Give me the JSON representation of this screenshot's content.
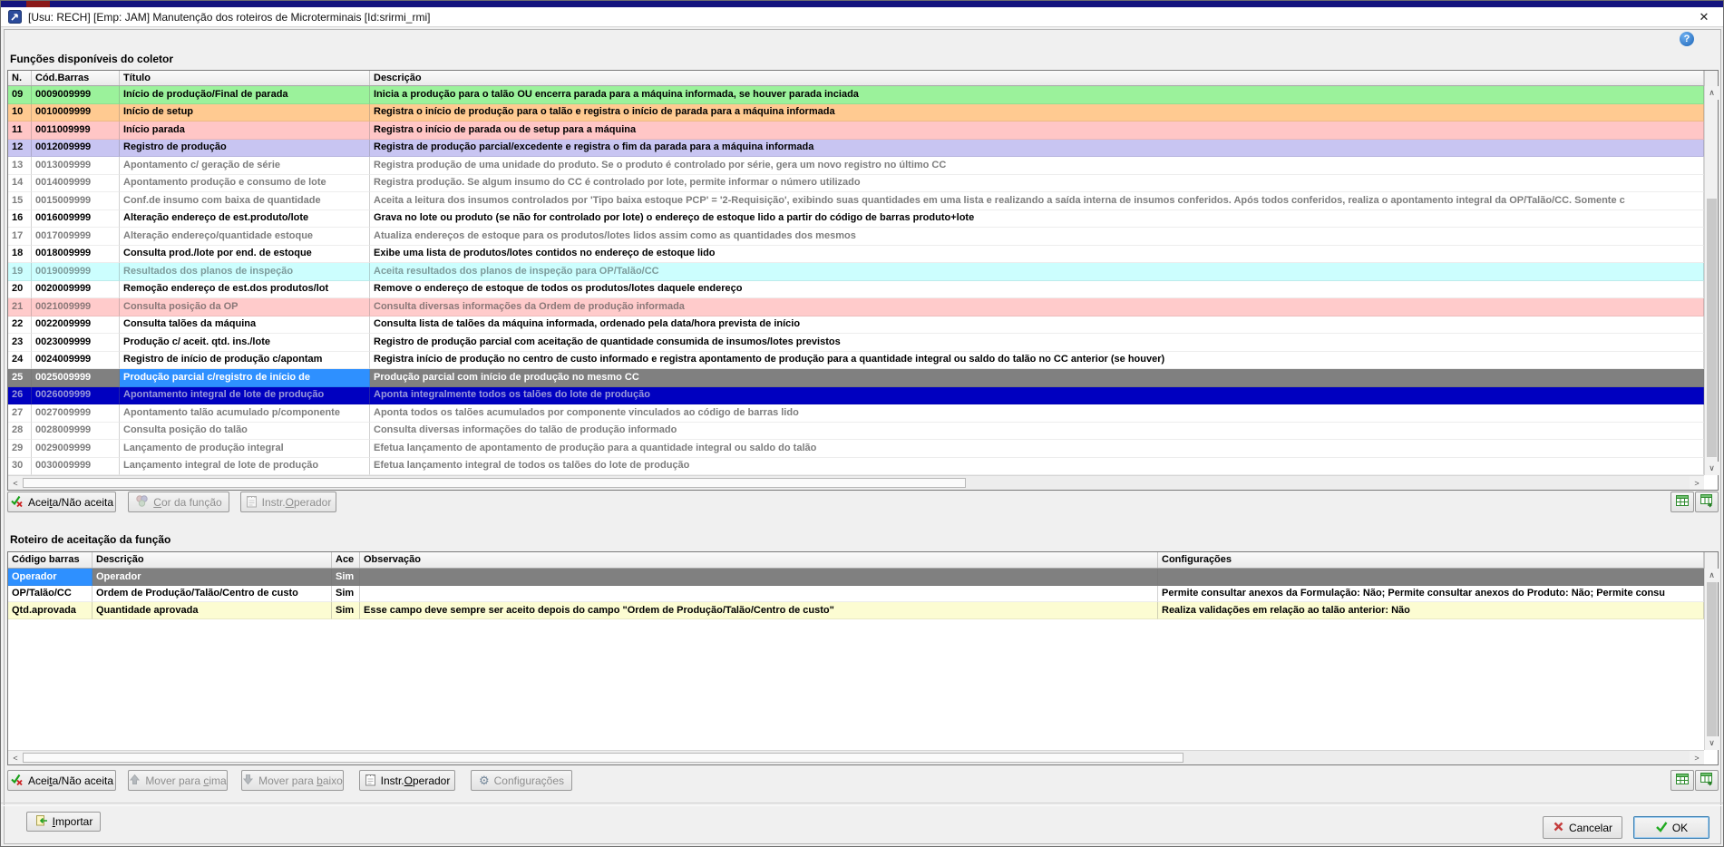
{
  "window": {
    "title": "[Usu: RECH] [Emp: JAM] Manutenção dos roteiros de Microterminais [Id:srirmi_rmi]"
  },
  "icons": {
    "close": "✕",
    "help": "?",
    "scroll_up": "∧",
    "scroll_down": "∨",
    "scroll_left": "<",
    "scroll_right": ">",
    "gear": "⚙"
  },
  "colors": {
    "selected_row": "#808080",
    "focused_cell": "#2E90FF",
    "row_green": "#9BF29B",
    "row_orange": "#FFCA91",
    "row_pink": "#FFC6C6",
    "row_lavender": "#C8C5F2",
    "row_cyan": "#CCFEFE",
    "row_pink2": "#FFCBCB",
    "row_navy": "#0000C0",
    "row_yellow": "#FCFCD2",
    "gray_text": "#7D7D7D"
  },
  "functions": {
    "label": "Funções disponíveis do coletor",
    "headers": [
      "N.",
      "Cód.Barras",
      "Título",
      "Descrição"
    ],
    "rows": [
      {
        "n": "09",
        "code": "0009009999",
        "title": "Início de produção/Final de parada",
        "desc": "Inicia a produção para o talão OU encerra parada para a máquina informada, se houver parada inciada",
        "bg": "#9BF29B"
      },
      {
        "n": "10",
        "code": "0010009999",
        "title": "Início de setup",
        "desc": "Registra o início de produção para o talão e registra o início de parada para a máquina informada",
        "bg": "#FFCA91"
      },
      {
        "n": "11",
        "code": "0011009999",
        "title": "Início parada",
        "desc": "Registra o início de parada ou de setup para a máquina",
        "bg": "#FFC6C6"
      },
      {
        "n": "12",
        "code": "0012009999",
        "title": "Registro de produção",
        "desc": "Registra de produção parcial/excedente e registra o fim da parada para a máquina informada",
        "bg": "#C8C5F2"
      },
      {
        "n": "13",
        "code": "0013009999",
        "title": "Apontamento c/ geração de série",
        "desc": "Registra produção de uma unidade do produto. Se o produto é controlado por série, gera um novo registro no último CC",
        "fg": "#7D7D7D"
      },
      {
        "n": "14",
        "code": "0014009999",
        "title": "Apontamento produção e consumo de lote",
        "desc": "Registra produção. Se algum insumo do CC é controlado por lote, permite informar o número utilizado",
        "fg": "#7D7D7D"
      },
      {
        "n": "15",
        "code": "0015009999",
        "title": "Conf.de insumo com baixa de quantidade",
        "desc": "Aceita a leitura dos insumos controlados por 'Tipo baixa estoque PCP' = '2-Requisição', exibindo suas quantidades em uma lista e realizando a saída interna de insumos conferidos. Após todos conferidos, realiza o apontamento integral da OP/Talão/CC. Somente c",
        "fg": "#7D7D7D"
      },
      {
        "n": "16",
        "code": "0016009999",
        "title": "Alteração endereço de est.produto/lote",
        "desc": "Grava no lote ou produto (se não for controlado por lote) o endereço de estoque lido a partir do código de barras produto+lote"
      },
      {
        "n": "17",
        "code": "0017009999",
        "title": "Alteração endereço/quantidade estoque",
        "desc": "Atualiza endereços de estoque para os produtos/lotes lidos assim como as quantidades dos mesmos",
        "fg": "#7D7D7D"
      },
      {
        "n": "18",
        "code": "0018009999",
        "title": "Consulta prod./lote por end. de estoque",
        "desc": "Exibe uma lista de produtos/lotes contidos no endereço de estoque lido"
      },
      {
        "n": "19",
        "code": "0019009999",
        "title": "Resultados dos planos de inspeção",
        "desc": "Aceita resultados dos planos de inspeção para OP/Talão/CC",
        "bg": "#CCFEFE",
        "fg": "#7D9B9B"
      },
      {
        "n": "20",
        "code": "0020009999",
        "title": "Remoção endereço de est.dos produtos/lot",
        "desc": "Remove o endereço de estoque de todos os produtos/lotes daquele endereço"
      },
      {
        "n": "21",
        "code": "0021009999",
        "title": "Consulta posição da OP",
        "desc": "Consulta diversas informações da Ordem de produção informada",
        "bg": "#FFCBCB",
        "fg": "#8A7878"
      },
      {
        "n": "22",
        "code": "0022009999",
        "title": "Consulta talões da máquina",
        "desc": "Consulta lista de talões da máquina informada, ordenado pela data/hora prevista de início"
      },
      {
        "n": "23",
        "code": "0023009999",
        "title": "Produção c/ aceit. qtd. ins./lote",
        "desc": "Registro de produção parcial com aceitação de quantidade consumida de insumos/lotes previstos"
      },
      {
        "n": "24",
        "code": "0024009999",
        "title": "Registro de início de produção c/apontam",
        "desc": "Registra início de produção no centro de custo informado e registra apontamento de produção para a quantidade integral ou saldo do talão no CC anterior (se houver)"
      },
      {
        "n": "25",
        "code": "0025009999",
        "title": "Produção parcial c/registro de início de",
        "desc": "Produção parcial com início de produção no mesmo CC",
        "selected": true,
        "focus_col": 2
      },
      {
        "n": "26",
        "code": "0026009999",
        "title": "Apontamento integral de lote de produção",
        "desc": "Aponta integralmente todos os talões do lote de produção",
        "bg": "#0000C0",
        "fg": "#9A99D9"
      },
      {
        "n": "27",
        "code": "0027009999",
        "title": "Apontamento talão acumulado p/componente",
        "desc": "Aponta todos os talões acumulados por componente vinculados ao código de barras lido",
        "fg": "#7D7D7D"
      },
      {
        "n": "28",
        "code": "0028009999",
        "title": "Consulta posição do talão",
        "desc": "Consulta diversas informações do talão de produção informado",
        "fg": "#7D7D7D"
      },
      {
        "n": "29",
        "code": "0029009999",
        "title": "Lançamento de produção integral",
        "desc": "Efetua lançamento de apontamento de produção para a quantidade integral ou saldo do talão",
        "fg": "#7D7D7D"
      },
      {
        "n": "30",
        "code": "0030009999",
        "title": "Lançamento integral de lote de produção",
        "desc": "Efetua lançamento integral de todos os talões do lote de produção",
        "fg": "#7D7D7D"
      }
    ],
    "toolbar": [
      {
        "label": "Aceita/Não aceita",
        "enabled": true
      },
      {
        "label": "Cor da função",
        "enabled": false
      },
      {
        "label": "Instr.Operador",
        "enabled": false
      }
    ]
  },
  "route": {
    "label": "Roteiro de aceitação da função",
    "headers": [
      "Código barras",
      "Descrição",
      "Ace",
      "Observação",
      "Configurações"
    ],
    "rows": [
      {
        "code": "Operador",
        "desc": "Operador",
        "ace": "Sim",
        "obs": "",
        "config": "",
        "selected": true,
        "focus_col": 0
      },
      {
        "code": "OP/Talão/CC",
        "desc": "Ordem de Produção/Talão/Centro de custo",
        "ace": "Sim",
        "obs": "",
        "config": "Permite consultar anexos da Formulação: Não; Permite consultar anexos do Produto: Não; Permite consu"
      },
      {
        "code": "Qtd.aprovada",
        "desc": "Quantidade aprovada",
        "ace": "Sim",
        "obs": "Esse campo deve sempre ser aceito depois do campo \"Ordem de Produção/Talão/Centro de custo\"",
        "config": "Realiza validações em relação ao talão anterior: Não",
        "bg": "#FCFCD2"
      }
    ],
    "toolbar": [
      {
        "label": "Aceita/Não aceita",
        "enabled": true
      },
      {
        "label": "Mover para cima",
        "enabled": false
      },
      {
        "label": "Mover para baixo",
        "enabled": false
      },
      {
        "label": "Instr.Operador",
        "enabled": true
      },
      {
        "label": "Configurações",
        "enabled": false
      }
    ]
  },
  "footer": {
    "import_label": "Importar",
    "cancel_label": "Cancelar",
    "ok_label": "OK"
  }
}
